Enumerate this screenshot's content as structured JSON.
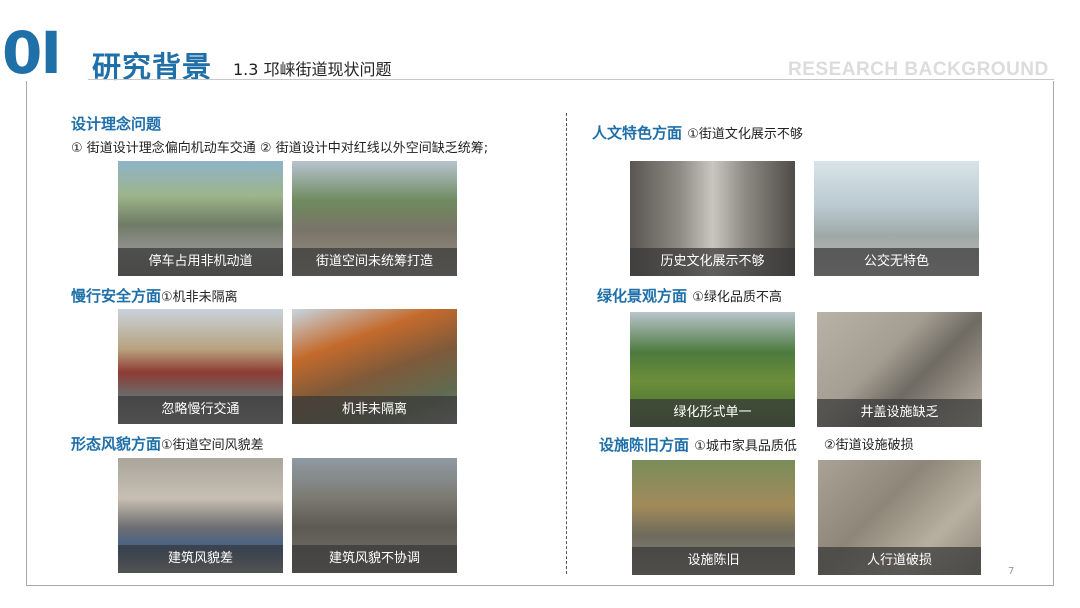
{
  "header": {
    "section_number": "0I",
    "title": "研究背景",
    "subtitle": "1.3 邛崃街道现状问题",
    "english_title": "RESEARCH BACKGROUND"
  },
  "left_sections": [
    {
      "heading": "设计理念问题",
      "notes": "① 街道设计理念偏向机动车交通   ② 街道设计中对红线以外空间缺乏统筹;",
      "photos": [
        "停车占用非机动道",
        "街道空间未统筹打造"
      ]
    },
    {
      "heading": "慢行安全方面",
      "notes": "①机非未隔离",
      "photos": [
        "忽略慢行交通",
        "机非未隔离"
      ]
    },
    {
      "heading": "形态风貌方面",
      "notes": "①街道空间风貌差",
      "photos": [
        "建筑风貌差",
        "建筑风貌不协调"
      ]
    }
  ],
  "right_sections": [
    {
      "heading": "人文特色方面",
      "notes": "①街道文化展示不够",
      "photos": [
        "历史文化展示不够",
        "公交无特色"
      ]
    },
    {
      "heading": "绿化景观方面",
      "notes": "①绿化品质不高",
      "photos": [
        "绿化形式单一",
        "井盖设施缺乏"
      ]
    },
    {
      "heading": "设施陈旧方面",
      "notes": "①城市家具品质低",
      "extra_note": "②街道设施破损",
      "photos": [
        "设施陈旧",
        "人行道破损"
      ]
    }
  ],
  "page_number": "7"
}
